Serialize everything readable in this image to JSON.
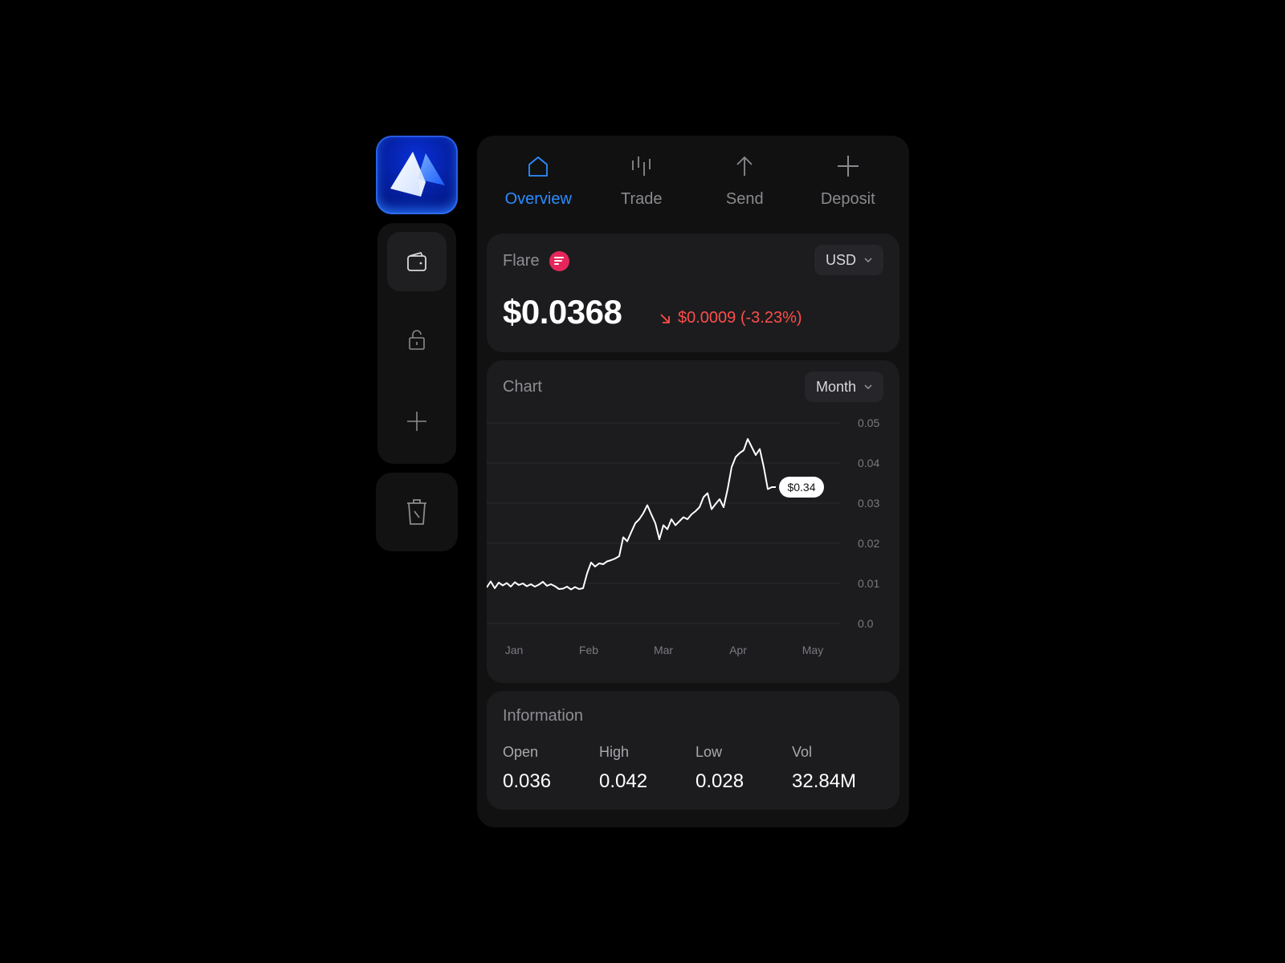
{
  "app": {
    "logo_name": "app-logo"
  },
  "rail": {
    "items": [
      {
        "name": "wallet",
        "active": true
      },
      {
        "name": "unlock",
        "active": false
      },
      {
        "name": "add",
        "active": false
      }
    ],
    "trash": {
      "name": "trash"
    }
  },
  "tabs": [
    {
      "label": "Overview",
      "icon": "home-icon",
      "active": true
    },
    {
      "label": "Trade",
      "icon": "candles-icon",
      "active": false
    },
    {
      "label": "Send",
      "icon": "arrow-up-icon",
      "active": false
    },
    {
      "label": "Deposit",
      "icon": "plus-icon",
      "active": false
    }
  ],
  "asset": {
    "name": "Flare",
    "currency": "USD",
    "price": "$0.0368",
    "change": "$0.0009 (-3.23%)",
    "change_direction": "down",
    "change_color": "#ff4d4a"
  },
  "chart_card": {
    "title": "Chart",
    "period": "Month"
  },
  "chart_data": {
    "type": "line",
    "title": "Chart",
    "xlabel": "",
    "ylabel": "",
    "x_ticks": [
      "Jan",
      "Feb",
      "Mar",
      "Apr",
      "May"
    ],
    "y_ticks": [
      "0.0",
      "0.01",
      "0.02",
      "0.03",
      "0.04",
      "0.05"
    ],
    "ylim": [
      0,
      0.05
    ],
    "grid": true,
    "current_value_label": "$0.34",
    "series": [
      {
        "name": "Flare price",
        "color": "#ffffff",
        "x": [
          0,
          0.05,
          0.1,
          0.15,
          0.2,
          0.25,
          0.3,
          0.35,
          0.4,
          0.45,
          0.5,
          0.55,
          0.6,
          0.65,
          0.7,
          0.75,
          0.8,
          0.85,
          0.9,
          0.95,
          1.0,
          1.05,
          1.1,
          1.15,
          1.2,
          1.25,
          1.3,
          1.35,
          1.4,
          1.45,
          1.5,
          1.55,
          1.6,
          1.65,
          1.7,
          1.75,
          1.8,
          1.85,
          1.9,
          1.95,
          2.0,
          2.05,
          2.1,
          2.15,
          2.2,
          2.25,
          2.3,
          2.35,
          2.4,
          2.45,
          2.5,
          2.55,
          2.6,
          2.65,
          2.7,
          2.75,
          2.8,
          2.85,
          2.9,
          2.95,
          3.0,
          3.05,
          3.1,
          3.15,
          3.2,
          3.25,
          3.3,
          3.35,
          3.4,
          3.45,
          3.5,
          3.55,
          3.6,
          3.65,
          3.7,
          3.75,
          3.8,
          3.85,
          3.9,
          3.95,
          4.0,
          4.05,
          4.1,
          4.15,
          4.2,
          4.25,
          4.3,
          4.35,
          4.4
        ],
        "values": [
          0.009,
          0.0105,
          0.0088,
          0.0102,
          0.0095,
          0.0101,
          0.0092,
          0.0103,
          0.0096,
          0.01,
          0.0093,
          0.0098,
          0.0092,
          0.0097,
          0.0104,
          0.0094,
          0.0098,
          0.0093,
          0.0086,
          0.0087,
          0.0092,
          0.0085,
          0.0091,
          0.0086,
          0.0088,
          0.0125,
          0.0152,
          0.0142,
          0.015,
          0.0148,
          0.0155,
          0.0158,
          0.0162,
          0.0168,
          0.0215,
          0.0205,
          0.0228,
          0.025,
          0.026,
          0.0275,
          0.0295,
          0.0272,
          0.025,
          0.021,
          0.0245,
          0.0235,
          0.026,
          0.0245,
          0.0255,
          0.0265,
          0.026,
          0.0272,
          0.028,
          0.029,
          0.0315,
          0.0325,
          0.0285,
          0.0298,
          0.031,
          0.029,
          0.0335,
          0.039,
          0.0415,
          0.0425,
          0.0432,
          0.046,
          0.044,
          0.042,
          0.0435,
          0.039,
          0.0335,
          0.034,
          0.034
        ]
      }
    ]
  },
  "information": {
    "title": "Information",
    "stats": [
      {
        "label": "Open",
        "value": "0.036"
      },
      {
        "label": "High",
        "value": "0.042"
      },
      {
        "label": "Low",
        "value": "0.028"
      },
      {
        "label": "Vol",
        "value": "32.84M"
      }
    ]
  }
}
